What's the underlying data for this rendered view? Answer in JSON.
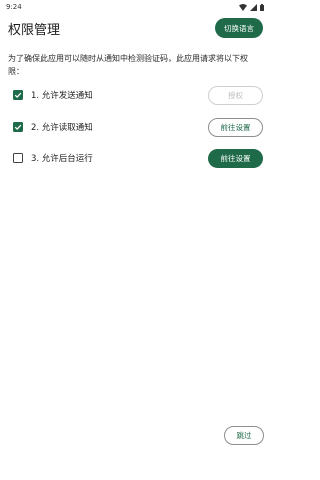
{
  "status_bar": {
    "time": "9:24"
  },
  "header": {
    "title": "权限管理",
    "switch_language_label": "切换语言"
  },
  "description": "为了确保此应用可以随时从通知中检测验证码，此应用请求将以下权限：",
  "permissions": [
    {
      "label": "1. 允许发送通知",
      "checked": true,
      "button_label": "授权",
      "button_state": "disabled"
    },
    {
      "label": "2. 允许读取通知",
      "checked": true,
      "button_label": "前往设置",
      "button_state": "outline"
    },
    {
      "label": "3. 允许后台运行",
      "checked": false,
      "button_label": "前往设置",
      "button_state": "filled"
    }
  ],
  "footer": {
    "skip_label": "跳过"
  },
  "colors": {
    "accent": "#1e6a49",
    "disabled": "#bdbdbd",
    "background": "#ffffff"
  },
  "icons": {
    "status": [
      "wifi-icon",
      "signal-icon",
      "battery-icon"
    ],
    "checkbox_checked": "check-icon"
  }
}
